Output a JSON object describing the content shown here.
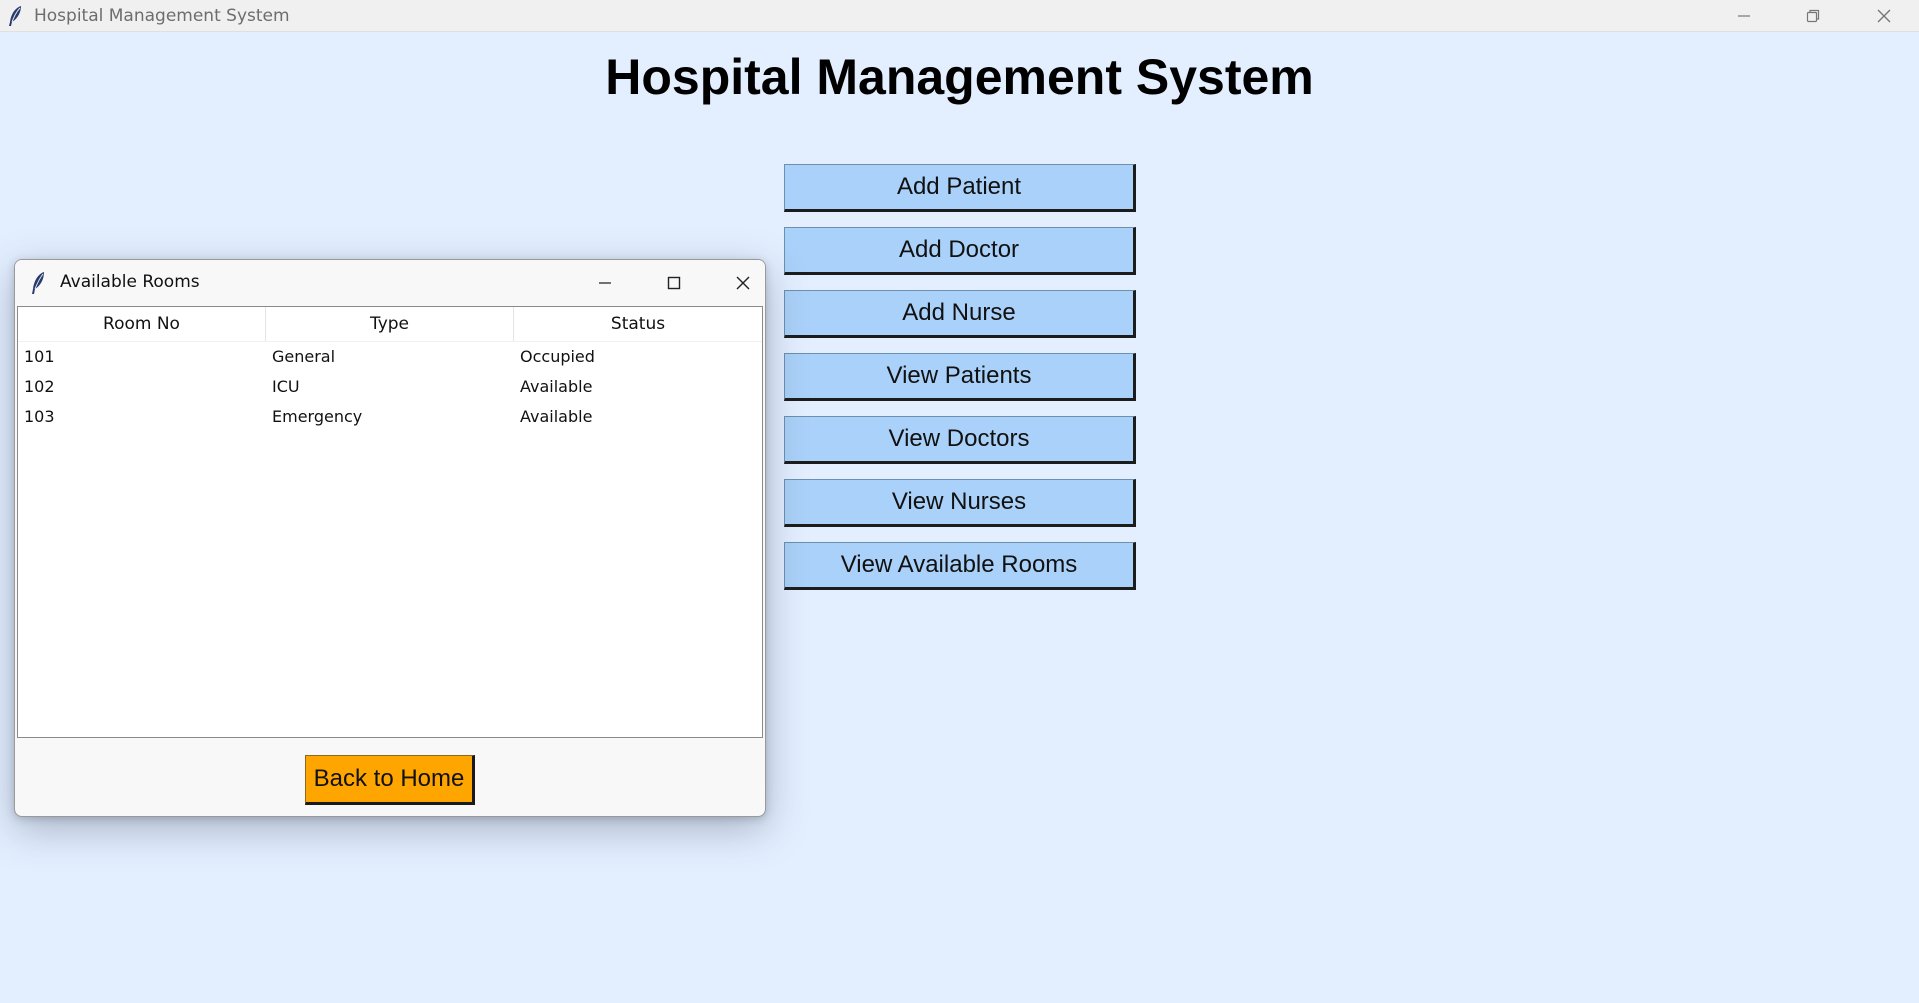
{
  "window": {
    "title": "Hospital Management System",
    "icon": "feather-icon"
  },
  "main": {
    "heading": "Hospital Management System",
    "buttons": [
      {
        "label": "Add Patient"
      },
      {
        "label": "Add Doctor"
      },
      {
        "label": "Add Nurse"
      },
      {
        "label": "View Patients"
      },
      {
        "label": "View Doctors"
      },
      {
        "label": "View Nurses"
      },
      {
        "label": "View Available Rooms"
      }
    ]
  },
  "popup": {
    "title": "Available Rooms",
    "icon": "feather-icon",
    "columns": [
      "Room No",
      "Type",
      "Status"
    ],
    "rows": [
      [
        "101",
        "General",
        "Occupied"
      ],
      [
        "102",
        "ICU",
        "Available"
      ],
      [
        "103",
        "Emergency",
        "Available"
      ]
    ],
    "back_label": "Back to Home"
  },
  "colors": {
    "background": "#e3efff",
    "menu_button": "#aad1f9",
    "back_button": "#ffa500"
  }
}
